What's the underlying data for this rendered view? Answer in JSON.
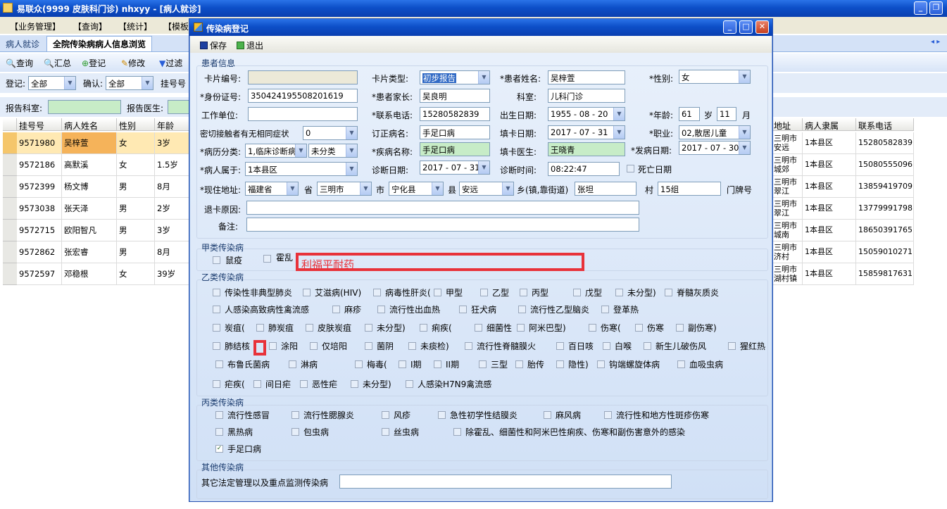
{
  "app": {
    "title": "易联众(9999 皮肤科门诊) nhxyy - [病人就诊]"
  },
  "menu": [
    "【业务管理】",
    "【查询】",
    "【统计】",
    "【模板"
  ],
  "tabs": [
    "病人就诊",
    "全院传染病病人信息浏览"
  ],
  "toolbar": [
    "查询",
    "汇总",
    "登记",
    "修改",
    "过滤"
  ],
  "filters": {
    "reg_label": "登记:",
    "reg_value": "全部",
    "confirm_label": "确认:",
    "confirm_value": "全部",
    "card_label": "挂号号",
    "dept_label": "报告科室:",
    "doctor_label": "报告医生:"
  },
  "table": {
    "headers": [
      "挂号号",
      "病人姓名",
      "性别",
      "年龄"
    ],
    "rows": [
      [
        "9571980",
        "吴梓萱",
        "女",
        "3岁"
      ],
      [
        "9572186",
        "高默溪",
        "女",
        "1.5岁"
      ],
      [
        "9572399",
        "杨文博",
        "男",
        "8月"
      ],
      [
        "9573038",
        "张天泽",
        "男",
        "2岁"
      ],
      [
        "9572715",
        "欧阳智凡",
        "男",
        "3岁"
      ],
      [
        "9572862",
        "张宏睿",
        "男",
        "8月"
      ],
      [
        "9572597",
        "邓稳根",
        "女",
        "39岁"
      ]
    ],
    "right_headers": [
      "地址",
      "病人隶属",
      "联系电话"
    ],
    "right_rows": [
      [
        "三明市安远",
        "1本县区",
        "15280582839"
      ],
      [
        "三明市城郊",
        "1本县区",
        "15080555096"
      ],
      [
        "三明市翠江",
        "1本县区",
        "13859419709"
      ],
      [
        "三明市翠江",
        "1本县区",
        "13779991798"
      ],
      [
        "三明市城南",
        "1本县区",
        "18650391765"
      ],
      [
        "三明市济村",
        "1本县区",
        "15059010271"
      ],
      [
        "三明市湖村镇",
        "1本县区",
        "15859817631"
      ]
    ]
  },
  "dialog": {
    "title": "传染病登记",
    "save": "保存",
    "exit": "退出",
    "patient_group": "患者信息",
    "card_no_label": "卡片编号:",
    "card_type_label": "卡片类型:",
    "card_type_value": "初步报告",
    "name_label": "*患者姓名:",
    "name_value": "吴梓萱",
    "sex_label": "*性别:",
    "sex_value": "女",
    "id_label": "*身份证号:",
    "id_value": "350424195508201619",
    "parent_label": "*患者家长:",
    "parent_value": "吴良明",
    "dept_label": "科室:",
    "dept_value": "儿科门诊",
    "work_label": "工作单位:",
    "phone_label": "*联系电话:",
    "phone_value": "15280582839",
    "birth_label": "出生日期:",
    "birth_value": "1955 - 08 - 20",
    "age_label": "*年龄:",
    "age_value": "61",
    "age_unit": "岁",
    "month_value": "11",
    "month_unit": "月",
    "contact_label": "密切接触者有无相同症状",
    "contact_value": "0",
    "revised_label": "订正病名:",
    "revised_value": "手足口病",
    "fill_date_label": "填卡日期:",
    "fill_date_value": "2017 - 07 - 31",
    "job_label": "*职业:",
    "job_value": "02,散居儿童",
    "case_class_label": "*病历分类:",
    "case_class_value": "1,临床诊断病",
    "case_class2": "未分类",
    "disease_label": "*疾病名称:",
    "disease_value": "手足口病",
    "fill_doc_label": "填卡医生:",
    "fill_doc_value": "王晓青",
    "onset_label": "*发病日期:",
    "onset_value": "2017 - 07 - 30",
    "belong_label": "*病人属于:",
    "belong_value": "1本县区",
    "diag_date_label": "诊断日期:",
    "diag_date_value": "2017 - 07 - 31",
    "diag_time_label": "诊断时间:",
    "diag_time_value": "08:22:47",
    "death_label": "死亡日期",
    "addr_label": "*现住地址:",
    "province": "福建省",
    "province_unit": "省",
    "city": "三明市",
    "city_unit": "市",
    "county": "宁化县",
    "county_unit": "县",
    "town": "安远",
    "town_unit": "乡(镇,靠街道)",
    "village": "张坦",
    "village_unit": "村",
    "group": "15组",
    "door_unit": "门牌号",
    "return_label": "退卡原因:",
    "note_label": "备注:",
    "a_group": "甲类传染病",
    "a_items": [
      "鼠疫",
      "霍乱"
    ],
    "annotation": "利福平耐药",
    "b_group": "乙类传染病",
    "b_row1": [
      "传染性非典型肺炎",
      "艾滋病(HIV)",
      "病毒性肝炎(",
      "甲型",
      "乙型",
      "丙型",
      "戊型",
      "未分型)",
      "脊髓灰质炎"
    ],
    "b_row2": [
      "人感染高致病性禽流感",
      "麻疹",
      "流行性出血热",
      "狂犬病",
      "流行性乙型脑炎",
      "登革热"
    ],
    "b_row3": [
      "炭疽(",
      "肺炭疽",
      "皮肤炭疽",
      "未分型)",
      "痢疾(",
      "细菌性",
      "阿米巴型)",
      "伤寒(",
      "伤寒",
      "副伤寒)"
    ],
    "b_row4": [
      "肺结核",
      "涂阳",
      "仅培阳",
      "菌阴",
      "未痰检)",
      "流行性脊髓膜火",
      "百日咳",
      "白喉",
      "新生儿破伤风",
      "猩红热"
    ],
    "b_row5": [
      "布鲁氏菌病",
      "淋病",
      "梅毒(",
      "I期",
      "II期",
      "三型",
      "胎传",
      "隐性)",
      "钩端螺旋体病",
      "血吸虫病"
    ],
    "b_row6": [
      "疟疾(",
      "间日疟",
      "恶性疟",
      "未分型)",
      "人感染H7N9禽流感"
    ],
    "c_group": "丙类传染病",
    "c_row1": [
      "流行性感冒",
      "流行性腮腺炎",
      "风疹",
      "急性初学性结膜炎",
      "麻风病",
      "流行性和地方性斑疹伤寒"
    ],
    "c_row2": [
      "黑热病",
      "包虫病",
      "丝虫病",
      "除霍乱、细菌性和阿米巴性痢疾、伤寒和副伤害意外的感染"
    ],
    "c_row3": [
      "手足口病"
    ],
    "other_group": "其他传染病",
    "other_label": "其它法定管理以及重点监测传染病"
  }
}
